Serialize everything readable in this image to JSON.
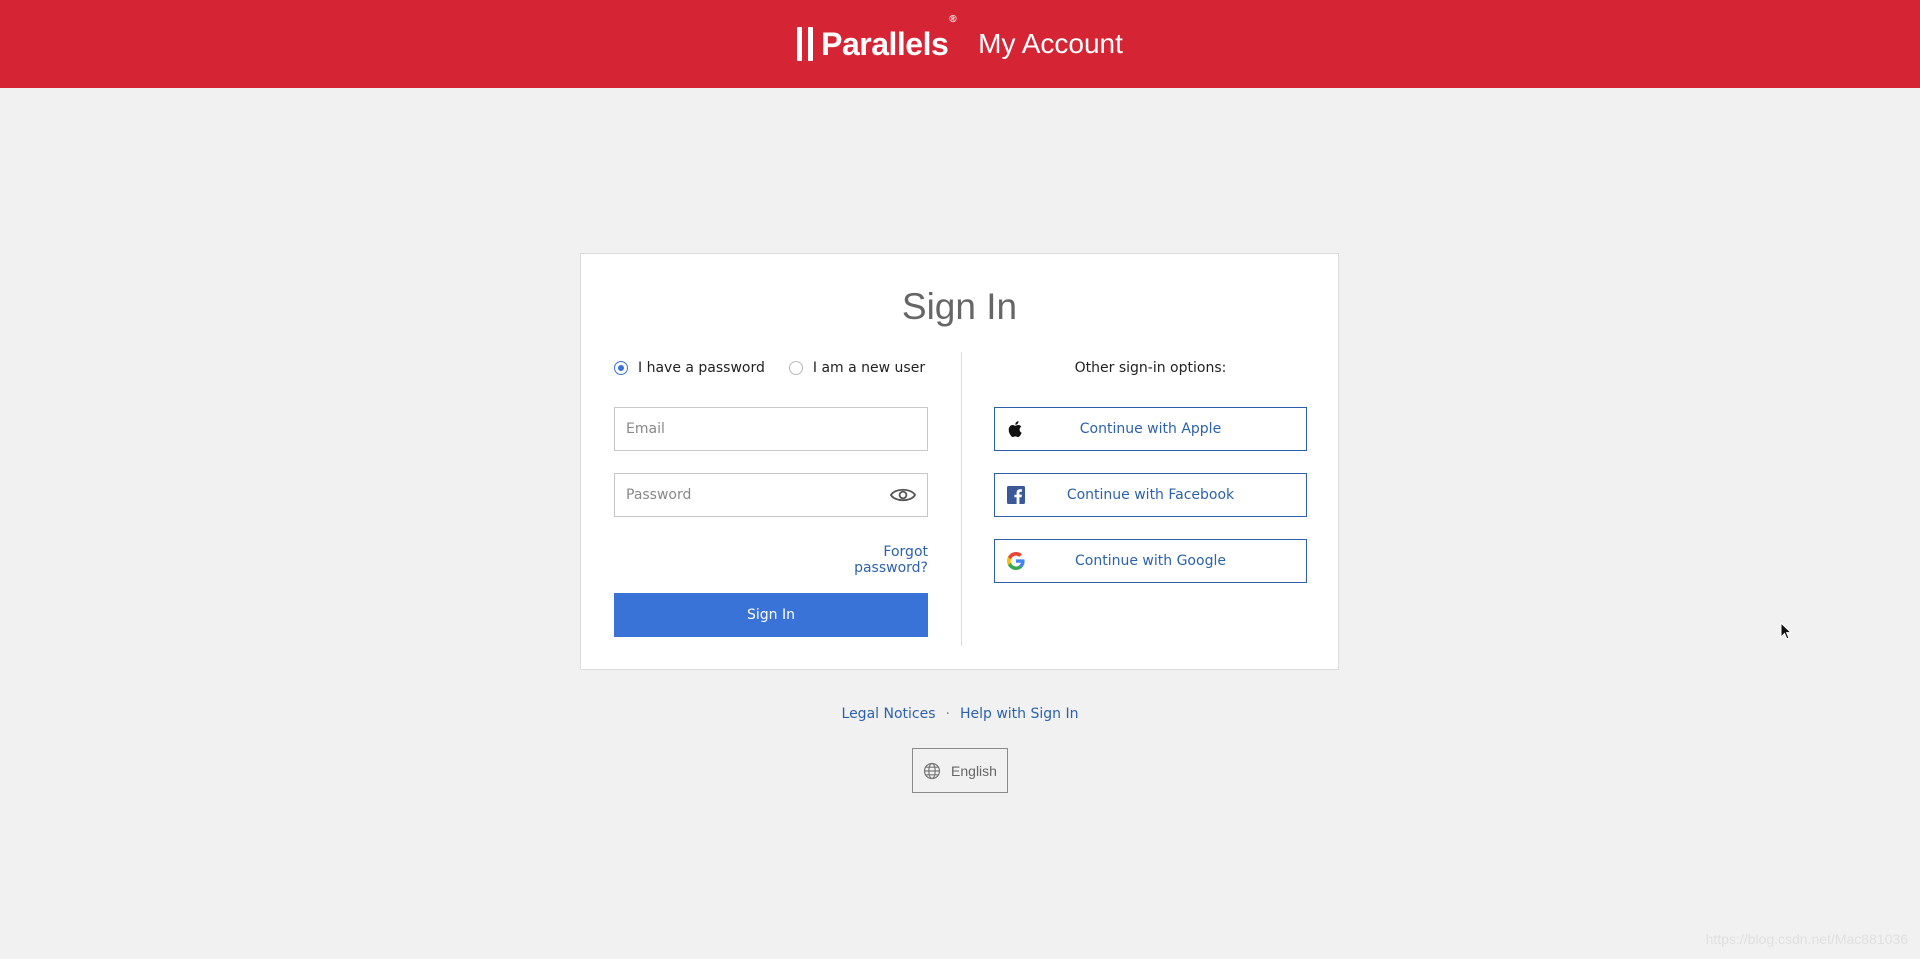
{
  "header": {
    "logo_text": "Parallels",
    "logo_reg": "®",
    "title": "My Account"
  },
  "signin": {
    "title": "Sign In",
    "radio_password_label": "I have a password",
    "radio_newuser_label": "I am a new user",
    "radio_selected": "password",
    "email_placeholder": "Email",
    "email_value": "",
    "password_placeholder": "Password",
    "password_value": "",
    "forgot_label": "Forgot password?",
    "button_label": "Sign In"
  },
  "other": {
    "label": "Other sign-in options:",
    "apple_label": "Continue with Apple",
    "facebook_label": "Continue with Facebook",
    "google_label": "Continue with Google"
  },
  "footer": {
    "legal_label": "Legal Notices",
    "separator": "·",
    "help_label": "Help with Sign In",
    "language_label": "English"
  },
  "watermark": "https://blog.csdn.net/Mac881036",
  "colors": {
    "brand_red": "#d52535",
    "primary_blue": "#3a73d8",
    "link_blue": "#2c62ad"
  },
  "icons": {
    "eye": "eye-icon",
    "apple": "apple-icon",
    "facebook": "facebook-icon",
    "google": "google-icon",
    "globe": "globe-icon"
  }
}
